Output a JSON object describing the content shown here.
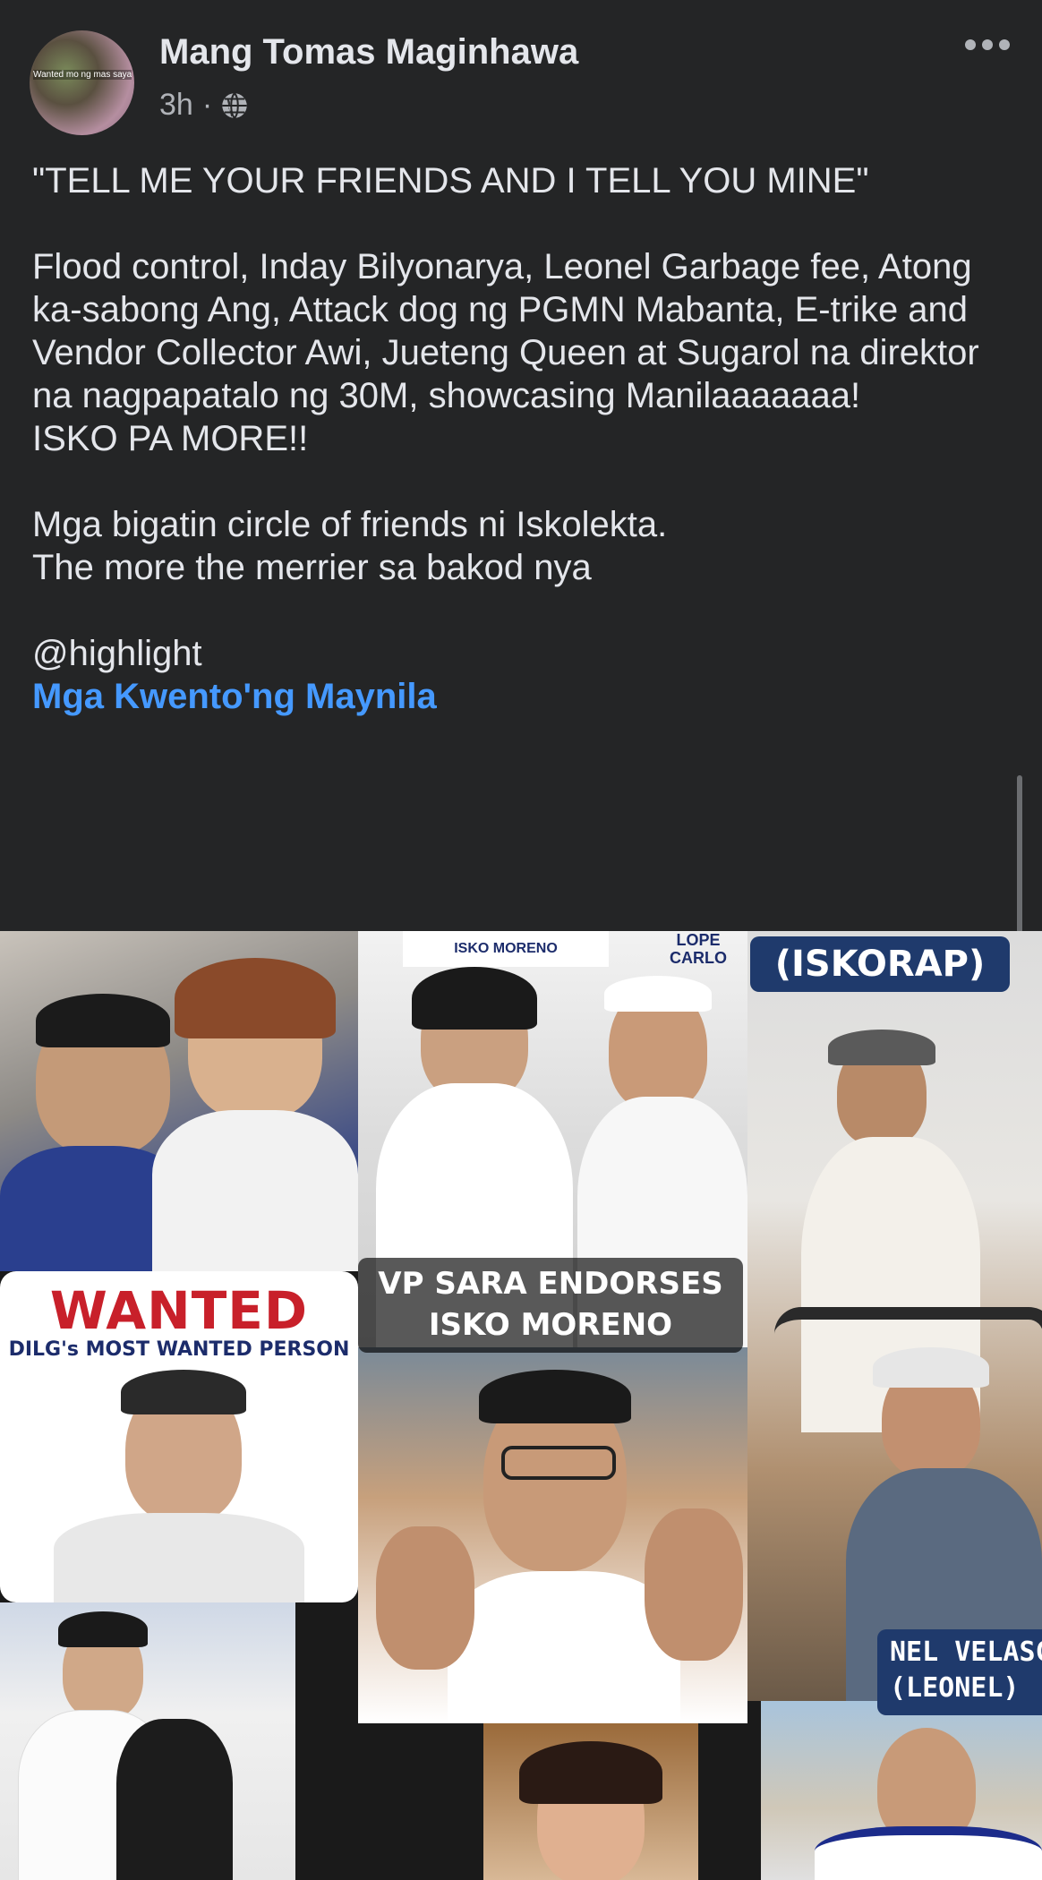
{
  "post": {
    "author": "Mang Tomas Maginhawa",
    "time": "3h",
    "separator": "·",
    "avatar_caption": "Wanted mo ng mas saya office",
    "paragraphs": [
      "\"TELL ME YOUR FRIENDS AND I TELL YOU MINE\"",
      "Flood control, Inday Bilyonarya, Leonel Garbage fee, Atong ka-sabong Ang, Attack dog ng PGMN Mabanta, E-trike and Vendor Collector Awi, Jueteng Queen at Sugarol na direktor na nagpapatalo ng 30M, showcasing Manilaaaaaaa!\nISKO PA MORE!!",
      "Mga bigatin circle of friends ni Iskolekta.\nThe more the merrier sa bakod nya",
      "@highlight"
    ],
    "group_link": "Mga Kwento'ng Maynila"
  },
  "collage": {
    "iskorap_label": "(ISKORAP)",
    "vp_label_line1": "VP SARA ENDORSES",
    "vp_label_line2": "ISKO MORENO",
    "wanted_title": "WANTED",
    "wanted_subtitle": "DILG's MOST WANTED PERSON",
    "nel_label_line1": "NEL VELASC",
    "nel_label_line2": "(LEONEL)",
    "poster_top_text": "ISKO MORENO",
    "poster_top_right": "LOPE CARLO"
  },
  "icons": {
    "more": "more-horizontal-icon",
    "audience": "globe-icon"
  },
  "colors": {
    "background": "#242526",
    "text": "#e4e6eb",
    "muted": "#b0b3b8",
    "link": "#4599ff"
  }
}
